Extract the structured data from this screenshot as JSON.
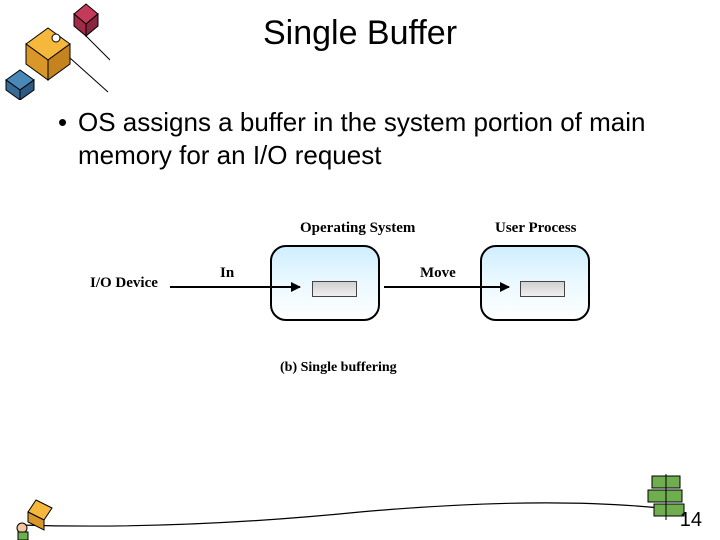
{
  "title": "Single Buffer",
  "bullet": "OS assigns a buffer in the system portion of main memory for an I/O request",
  "diagram": {
    "io_device": "I/O Device",
    "os": "Operating System",
    "user": "User Process",
    "in": "In",
    "move": "Move",
    "caption": "(b) Single buffering"
  },
  "page_number": "14"
}
